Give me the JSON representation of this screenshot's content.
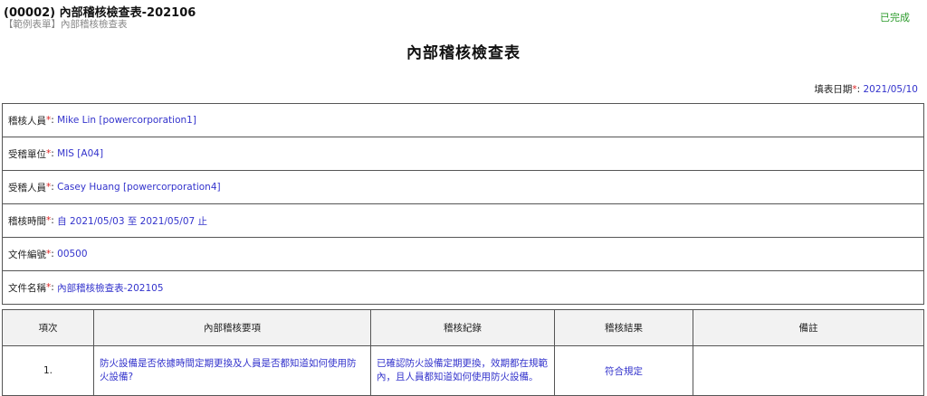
{
  "header": {
    "title": "(00002) 內部稽核檢查表-202106",
    "subtitle": "【範例表單】內部稽核檢查表",
    "status": "已完成"
  },
  "form": {
    "title": "內部稽核檢查表",
    "fill_date_label": "填表日期",
    "fill_date_value": "2021/05/10"
  },
  "fields": [
    {
      "label": "稽核人員",
      "value": "Mike Lin [powercorporation1]"
    },
    {
      "label": "受稽單位",
      "value": "MIS [A04]"
    },
    {
      "label": "受稽人員",
      "value": "Casey Huang [powercorporation4]"
    },
    {
      "label": "稽核時間",
      "value": "自 2021/05/03 至 2021/05/07 止"
    },
    {
      "label": "文件編號",
      "value": "00500"
    },
    {
      "label": "文件名稱",
      "value": "內部稽核檢查表-202105"
    }
  ],
  "table": {
    "headers": [
      "項次",
      "內部稽核要項",
      "稽核紀錄",
      "稽核結果",
      "備註"
    ],
    "rows": [
      {
        "no": "1.",
        "item": "防火設備是否依據時間定期更換及人員是否都知道如何使用防火設備?",
        "record": "已確認防火設備定期更換，效期都在規範內，且人員都知道如何使用防火設備。",
        "result": "符合規定",
        "note": ""
      }
    ]
  }
}
